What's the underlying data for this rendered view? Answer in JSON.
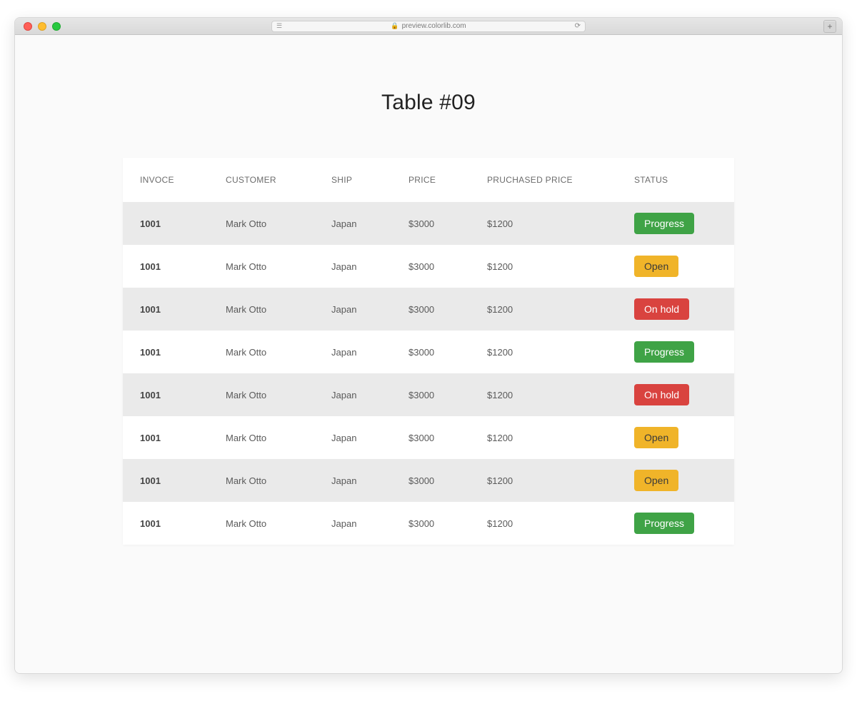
{
  "browser": {
    "url_host": "preview.colorlib.com"
  },
  "page": {
    "title": "Table #09"
  },
  "table": {
    "headers": {
      "invoice": "INVOCE",
      "customer": "CUSTOMER",
      "ship": "SHIP",
      "price": "PRICE",
      "purchased": "PRUCHASED PRICE",
      "status": "STATUS"
    },
    "rows": [
      {
        "invoice": "1001",
        "customer": "Mark Otto",
        "ship": "Japan",
        "price": "$3000",
        "purchased": "$1200",
        "status": "Progress"
      },
      {
        "invoice": "1001",
        "customer": "Mark Otto",
        "ship": "Japan",
        "price": "$3000",
        "purchased": "$1200",
        "status": "Open"
      },
      {
        "invoice": "1001",
        "customer": "Mark Otto",
        "ship": "Japan",
        "price": "$3000",
        "purchased": "$1200",
        "status": "On hold"
      },
      {
        "invoice": "1001",
        "customer": "Mark Otto",
        "ship": "Japan",
        "price": "$3000",
        "purchased": "$1200",
        "status": "Progress"
      },
      {
        "invoice": "1001",
        "customer": "Mark Otto",
        "ship": "Japan",
        "price": "$3000",
        "purchased": "$1200",
        "status": "On hold"
      },
      {
        "invoice": "1001",
        "customer": "Mark Otto",
        "ship": "Japan",
        "price": "$3000",
        "purchased": "$1200",
        "status": "Open"
      },
      {
        "invoice": "1001",
        "customer": "Mark Otto",
        "ship": "Japan",
        "price": "$3000",
        "purchased": "$1200",
        "status": "Open"
      },
      {
        "invoice": "1001",
        "customer": "Mark Otto",
        "ship": "Japan",
        "price": "$3000",
        "purchased": "$1200",
        "status": "Progress"
      }
    ]
  },
  "status_colors": {
    "Progress": "#3fa346",
    "Open": "#f0b429",
    "On hold": "#d9433f"
  }
}
